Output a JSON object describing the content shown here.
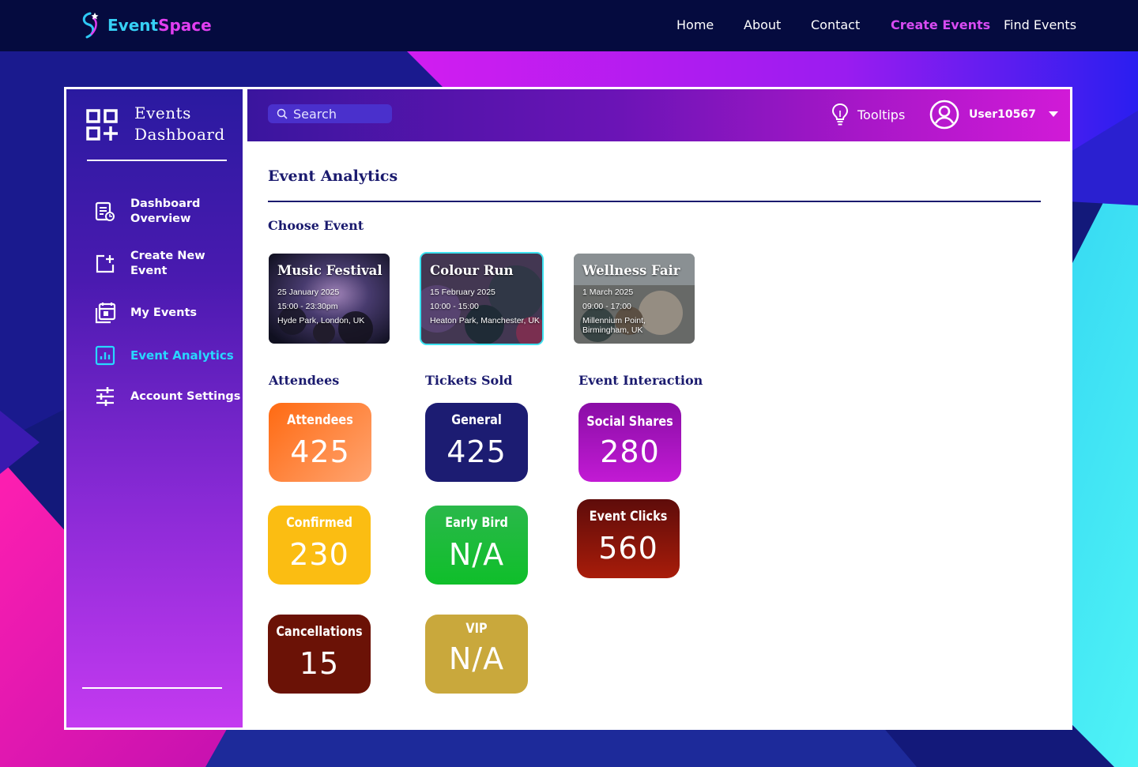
{
  "brand": {
    "name_part1": "Event",
    "name_part2": "Space"
  },
  "nav": [
    {
      "label": "Home",
      "active": false
    },
    {
      "label": "About",
      "active": false
    },
    {
      "label": "Contact",
      "active": false
    },
    {
      "label": "Create Events",
      "active": true
    },
    {
      "label": "Find Events",
      "active": false
    }
  ],
  "sidebar": {
    "title_line1": "Events",
    "title_line2": "Dashboard",
    "items": [
      {
        "label": "Dashboard\nOverview",
        "icon": "dashboard-overview-icon",
        "active": false
      },
      {
        "label": "Create New\nEvent",
        "icon": "add-box-icon",
        "active": false
      },
      {
        "label": "My Events",
        "icon": "calendar-stack-icon",
        "active": false
      },
      {
        "label": "Event Analytics",
        "icon": "analytics-icon",
        "active": true
      },
      {
        "label": "Account Settings",
        "icon": "sliders-icon",
        "active": false
      }
    ]
  },
  "header": {
    "search_placeholder": "Search",
    "tooltips_label": "Tooltips",
    "username": "User10567"
  },
  "main": {
    "title": "Event Analytics",
    "choose_label": "Choose Event",
    "events": [
      {
        "name": "Music Festival",
        "date": "25 January 2025",
        "time": "15:00 - 23:30pm",
        "location": "Hyde Park, London, UK",
        "selected": false
      },
      {
        "name": "Colour Run",
        "date": "15 February 2025",
        "time": "10:00 - 15:00",
        "location": "Heaton Park, Manchester, UK",
        "selected": true
      },
      {
        "name": "Wellness Fair",
        "date": "1 March 2025",
        "time": "09:00 - 17:00",
        "location": "Millennium Point, Birmingham, UK",
        "selected": false
      }
    ],
    "attendees": {
      "heading": "Attendees",
      "stats": [
        {
          "label": "Attendees",
          "value": "425"
        },
        {
          "label": "Confirmed",
          "value": "230"
        },
        {
          "label": "Cancellations",
          "value": "15"
        }
      ]
    },
    "tickets": {
      "heading": "Tickets Sold",
      "stats": [
        {
          "label": "General",
          "value": "425"
        },
        {
          "label": "Early Bird",
          "value": "N/A"
        },
        {
          "label": "VIP",
          "value": "N/A"
        }
      ]
    },
    "interaction": {
      "heading": "Event Interaction",
      "stats": [
        {
          "label": "Social Shares",
          "value": "280"
        },
        {
          "label": "Event Clicks",
          "value": "560"
        }
      ]
    }
  },
  "colors": {
    "active_nav": "#d84bf2",
    "active_sidebar": "#28d7ff",
    "heading": "#1a1a6e",
    "attendees": "#ff7a1f",
    "confirmed": "#fbbd12",
    "cancellations": "#6b1206",
    "general": "#1c1c72",
    "early_bird": "#19b53a",
    "vip": "#c9a83c",
    "social_shares": "#a516c2",
    "event_clicks": "#7a120a"
  }
}
